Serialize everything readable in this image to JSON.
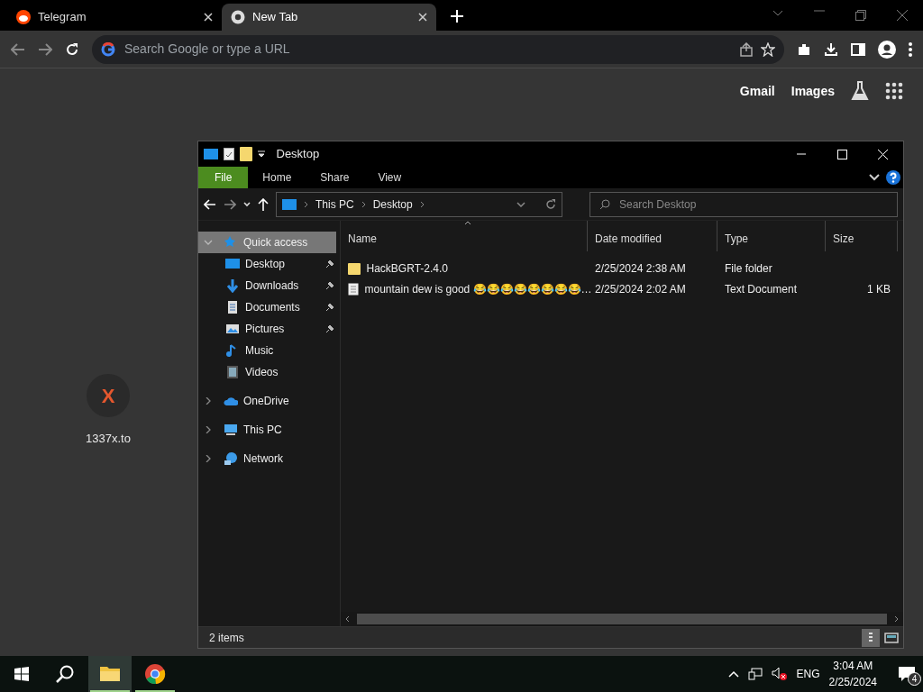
{
  "browser": {
    "tabs": [
      {
        "title": "Telegram",
        "kind": "reddit",
        "selected": false
      },
      {
        "title": "New Tab",
        "kind": "chrome",
        "selected": true
      }
    ],
    "omnibox": {
      "placeholder": "Search Google or type a URL"
    },
    "header_links": [
      "Gmail",
      "Images"
    ],
    "shortcuts": [
      {
        "label": "1337x.to",
        "glyph": "X"
      }
    ]
  },
  "explorer": {
    "title": "Desktop",
    "ribbon_tabs": [
      {
        "label": "File",
        "selected": true
      },
      {
        "label": "Home",
        "selected": false
      },
      {
        "label": "Share",
        "selected": false
      },
      {
        "label": "View",
        "selected": false
      }
    ],
    "breadcrumb": [
      "This PC",
      "Desktop"
    ],
    "search": {
      "placeholder": "Search Desktop"
    },
    "nav": [
      {
        "label": "Quick access",
        "kind": "star",
        "expanded": true,
        "selected": true,
        "children": [
          {
            "label": "Desktop",
            "kind": "desktop",
            "pinned": true,
            "selected": false
          },
          {
            "label": "Downloads",
            "kind": "download",
            "pinned": true,
            "selected": false
          },
          {
            "label": "Documents",
            "kind": "document",
            "pinned": true,
            "selected": false
          },
          {
            "label": "Pictures",
            "kind": "picture",
            "pinned": true,
            "selected": false
          },
          {
            "label": "Music",
            "kind": "music",
            "pinned": false,
            "selected": false
          },
          {
            "label": "Videos",
            "kind": "video",
            "pinned": false,
            "selected": false
          }
        ]
      },
      {
        "label": "OneDrive",
        "kind": "cloud",
        "expanded": false,
        "selected": false
      },
      {
        "label": "This PC",
        "kind": "pc",
        "expanded": false,
        "selected": false
      },
      {
        "label": "Network",
        "kind": "network",
        "expanded": false,
        "selected": false
      }
    ],
    "columns": [
      {
        "label": "Name",
        "sorted": true
      },
      {
        "label": "Date modified",
        "sorted": false
      },
      {
        "label": "Type",
        "sorted": false
      },
      {
        "label": "Size",
        "sorted": false
      }
    ],
    "rows": [
      {
        "kind": "folder",
        "name": "HackBGRT-2.4.0",
        "date": "2/25/2024 2:38 AM",
        "type": "File folder"
      },
      {
        "kind": "text",
        "name": "mountain dew is good 😂😂😂😂😂😂😂😂…",
        "date": "2/25/2024 2:02 AM",
        "type": "Text Document",
        "size": "1 KB"
      }
    ],
    "status": "2 items"
  },
  "taskbar": {
    "apps": [
      {
        "kind": "explorer",
        "active": true
      },
      {
        "kind": "chrome",
        "active": false
      }
    ],
    "language": "ENG",
    "time": "3:04 AM",
    "date": "2/25/2024",
    "notifications": "4"
  }
}
